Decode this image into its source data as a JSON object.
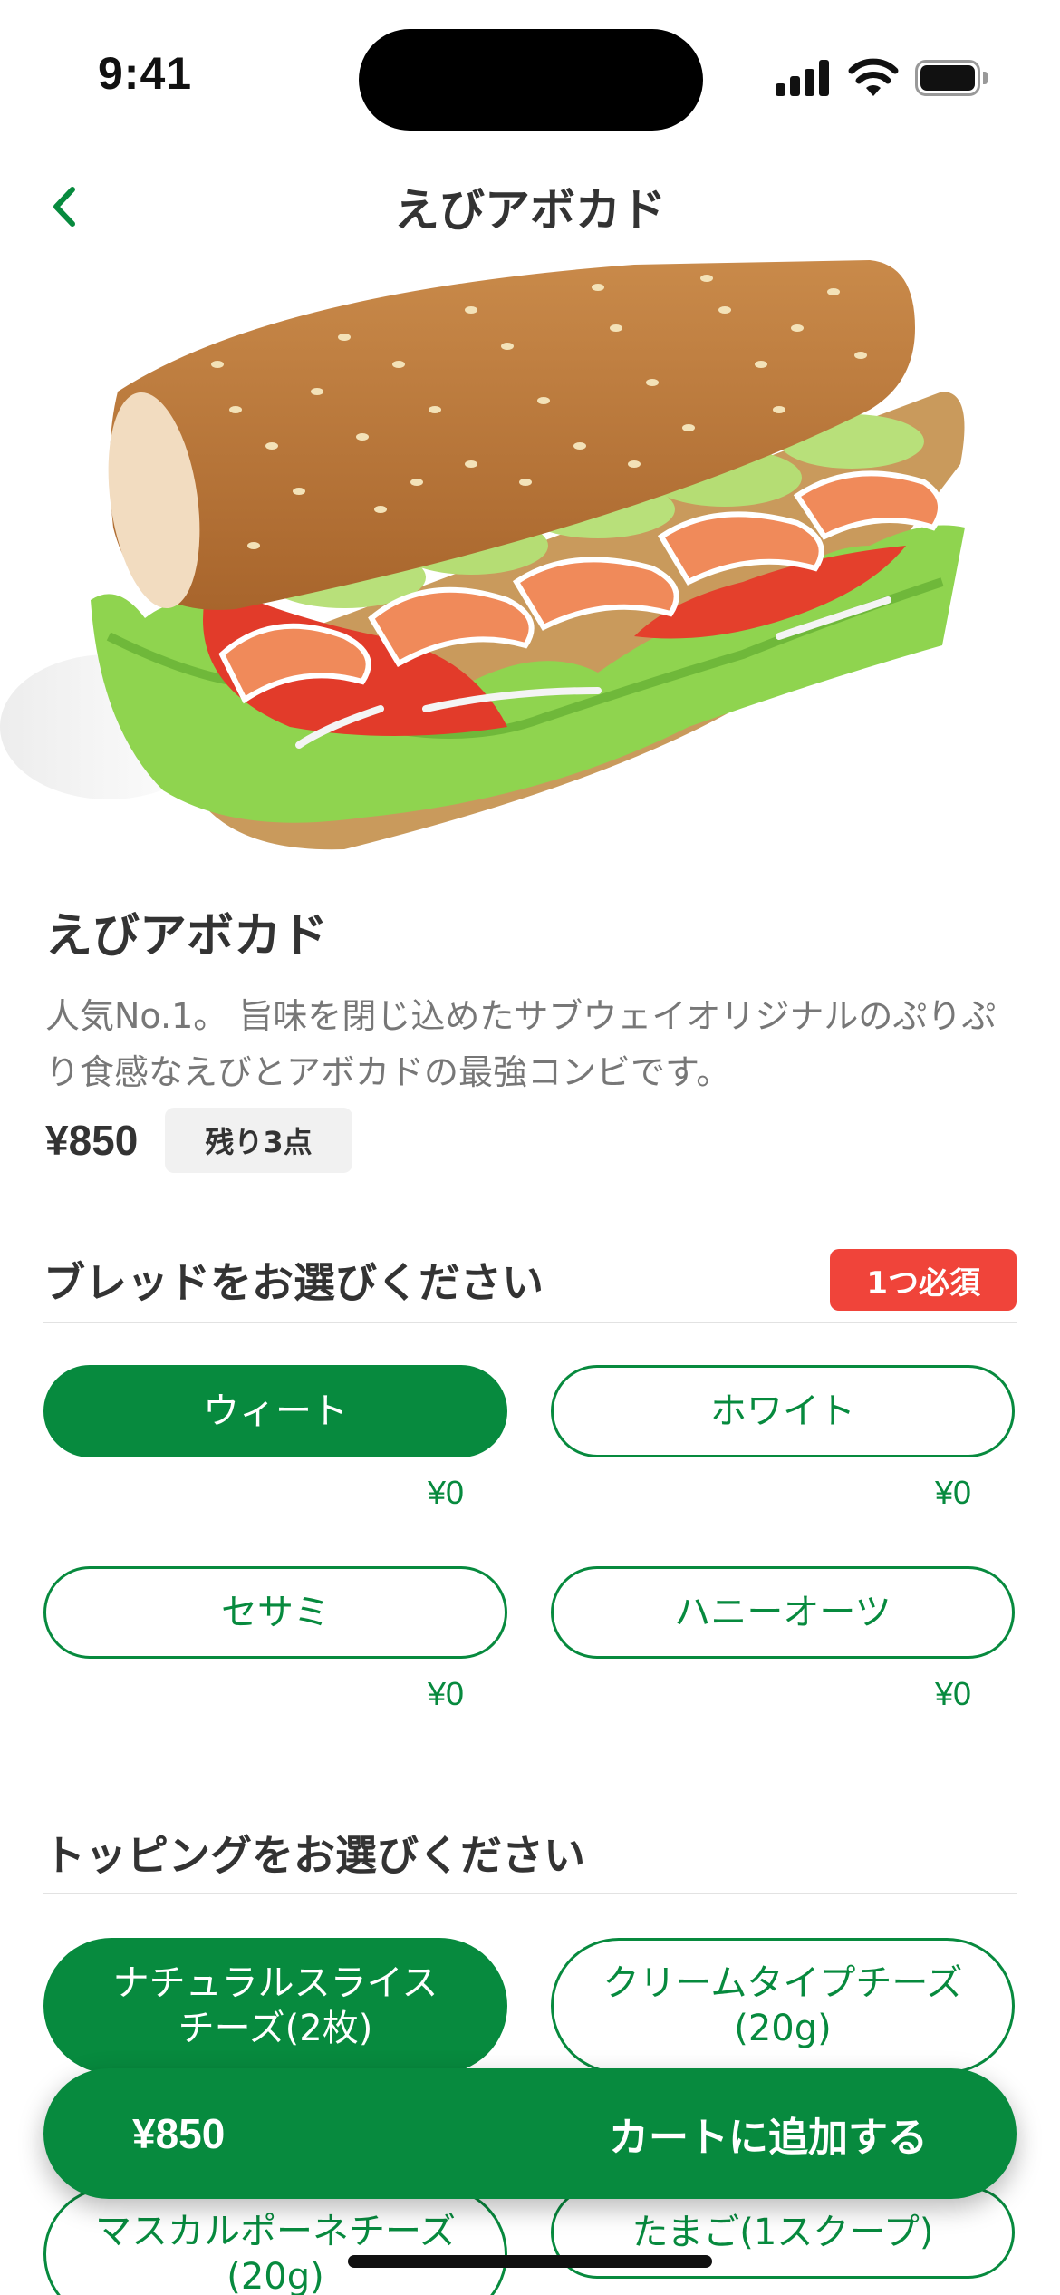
{
  "status_bar": {
    "time": "9:41"
  },
  "nav": {
    "title": "えびアボカド",
    "back_icon": "chevron-left-icon"
  },
  "product": {
    "name": "えびアボカド",
    "description": "人気No.1。 旨味を閉じ込めたサブウェイオリジナルのぷりぷり食感なえびとアボカドの最強コンビです。",
    "price": "¥850",
    "stock": "残り3点",
    "image_icon": "shrimp-avocado-sandwich-image"
  },
  "bread_section": {
    "title": "ブレッドをお選びください",
    "required_badge": "1つ必須",
    "options": [
      {
        "label": "ウィート",
        "price": "¥0",
        "selected": true
      },
      {
        "label": "ホワイト",
        "price": "¥0",
        "selected": false
      },
      {
        "label": "セサミ",
        "price": "¥0",
        "selected": false
      },
      {
        "label": "ハニーオーツ",
        "price": "¥0",
        "selected": false
      }
    ]
  },
  "topping_section": {
    "title": "トッピングをお選びください",
    "options": [
      {
        "label": "ナチュラルスライスチーズ(2枚)",
        "selected": true
      },
      {
        "label": "クリームタイプチーズ(20g)",
        "selected": false
      },
      {
        "label": "マスカルポーネチーズ(20g)",
        "selected": false
      },
      {
        "label": "たまご(1スクープ)",
        "selected": false
      }
    ]
  },
  "cart": {
    "price": "¥850",
    "label": "カートに追加する"
  },
  "colors": {
    "brand_green": "#078a3e",
    "required_red": "#f0443a"
  }
}
